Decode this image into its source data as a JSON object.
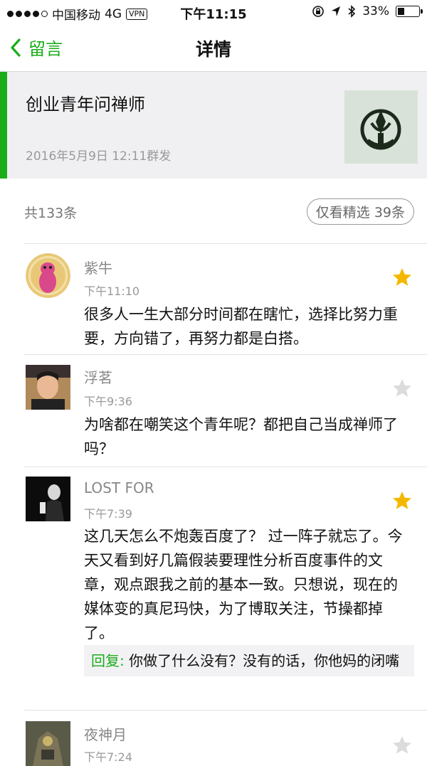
{
  "status_bar": {
    "carrier": "中国移动",
    "network": "4G",
    "vpn": "VPN",
    "time": "下午11:15",
    "battery": "33%"
  },
  "nav": {
    "back_label": "留言",
    "title": "详情"
  },
  "article": {
    "title": "创业青年问禅师",
    "date": "2016年5月9日 12:11群发"
  },
  "summary": {
    "count": "共133条",
    "featured_label": "仅看精选 39条"
  },
  "comments": [
    {
      "name": "紫牛",
      "time": "下午11:10",
      "text": "很多人一生大部分时间都在瞎忙，选择比努力重要，方向错了，再努力都是白搭。",
      "starred": true
    },
    {
      "name": "浮茗",
      "time": "下午9:36",
      "text": "为啥都在嘲笑这个青年呢？都把自己当成禅师了吗？",
      "starred": false
    },
    {
      "name": "LOST FOR",
      "time": "下午7:39",
      "text": "这几天怎么不炮轰百度了？ 过一阵子就忘了。今天又看到好几篇假装要理性分析百度事件的文章，观点跟我之前的基本一致。只想说，现在的媒体变的真尼玛快，为了博取关注，节操都掉了。",
      "starred": true,
      "reply_label": "回复:",
      "reply_text": "你做了什么没有？没有的话，你他妈的闭嘴"
    },
    {
      "name": "夜神月",
      "time": "下午7:24",
      "starred": false
    }
  ],
  "colors": {
    "accent": "#1aad19",
    "star_on": "#f5b800",
    "star_off": "#dcdcdc"
  }
}
